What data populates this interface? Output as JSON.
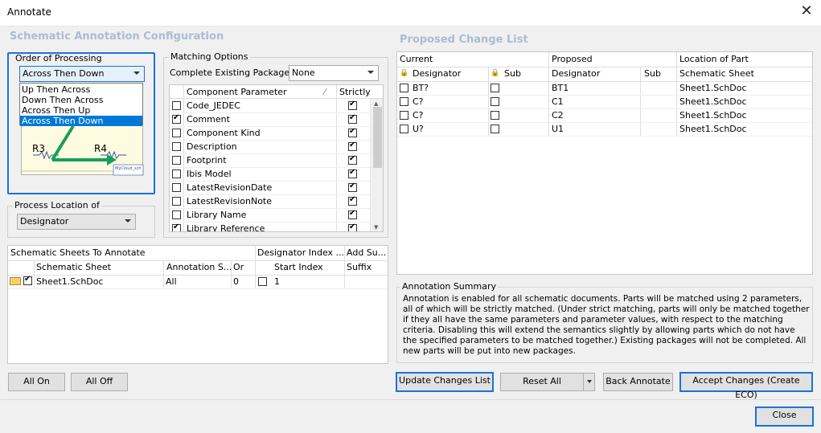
{
  "window": {
    "title": "Annotate"
  },
  "left": {
    "heading": "Schematic Annotation Configuration",
    "order": {
      "legend": "Order of Processing",
      "selected": "Across Then Down",
      "options": [
        "Up Then Across",
        "Down Then Across",
        "Across Then Up",
        "Across Then Down"
      ],
      "preview": {
        "r3": "R3",
        "r4": "R4",
        "label": "MyCloud_sch"
      }
    },
    "process_location": {
      "legend": "Process Location of",
      "value": "Designator"
    },
    "matching": {
      "legend": "Matching Options",
      "complete_label": "Complete Existing Packages",
      "complete_value": "None",
      "col_param": "Component Parameter",
      "col_strict": "Strictly",
      "rows": [
        {
          "name": "Code_JEDEC",
          "checked": false
        },
        {
          "name": "Comment",
          "checked": true
        },
        {
          "name": "Component Kind",
          "checked": false
        },
        {
          "name": "Description",
          "checked": false
        },
        {
          "name": "Footprint",
          "checked": false
        },
        {
          "name": "Ibis Model",
          "checked": false
        },
        {
          "name": "LatestRevisionDate",
          "checked": false
        },
        {
          "name": "LatestRevisionNote",
          "checked": false
        },
        {
          "name": "Library Name",
          "checked": false
        },
        {
          "name": "Library Reference",
          "checked": true
        }
      ]
    },
    "sheets": {
      "group1": "Schematic Sheets To Annotate",
      "group2": "Designator Index ...",
      "group3": "Add Su...",
      "col_sheet": "Schematic Sheet",
      "col_scope": "Annotation S...",
      "col_order": "Or",
      "col_start": "Start Index",
      "col_suffix": "Suffix",
      "rows": [
        {
          "sheet": "Sheet1.SchDoc",
          "scope": "All",
          "order": "0",
          "start": "1",
          "suffix": ""
        }
      ]
    },
    "buttons": {
      "all_on": "All On",
      "all_off": "All Off"
    }
  },
  "right": {
    "heading": "Proposed Change List",
    "groups": {
      "current": "Current",
      "proposed": "Proposed",
      "location": "Location of Part"
    },
    "cols": {
      "designator": "Designator",
      "sub": "Sub",
      "pdesignator": "Designator",
      "psub": "Sub",
      "sheet": "Schematic Sheet"
    },
    "rows": [
      {
        "current": "BT?",
        "proposed": "BT1",
        "sheet": "Sheet1.SchDoc"
      },
      {
        "current": "C?",
        "proposed": "C1",
        "sheet": "Sheet1.SchDoc"
      },
      {
        "current": "C?",
        "proposed": "C2",
        "sheet": "Sheet1.SchDoc"
      },
      {
        "current": "U?",
        "proposed": "U1",
        "sheet": "Sheet1.SchDoc"
      }
    ],
    "summary": {
      "legend": "Annotation Summary",
      "text": "Annotation is enabled for all schematic documents. Parts will be matched using 2 parameters, all of which will be strictly matched. (Under strict matching, parts will only be matched together if they all have the same parameters and parameter values, with respect to the matching criteria. Disabling this will extend the semantics slightly by allowing parts which do not have the specified parameters to be matched together.) Existing packages will not be completed. All new parts will be put into new packages."
    },
    "buttons": {
      "update": "Update Changes List",
      "reset": "Reset All",
      "back": "Back Annotate",
      "accept": "Accept Changes (Create ECO)"
    }
  },
  "footer": {
    "close": "Close"
  },
  "colors": {
    "accent": "#1a73d9",
    "heading": "#a9bdd6",
    "selection": "#0078d7",
    "arrow": "#14a05a"
  }
}
